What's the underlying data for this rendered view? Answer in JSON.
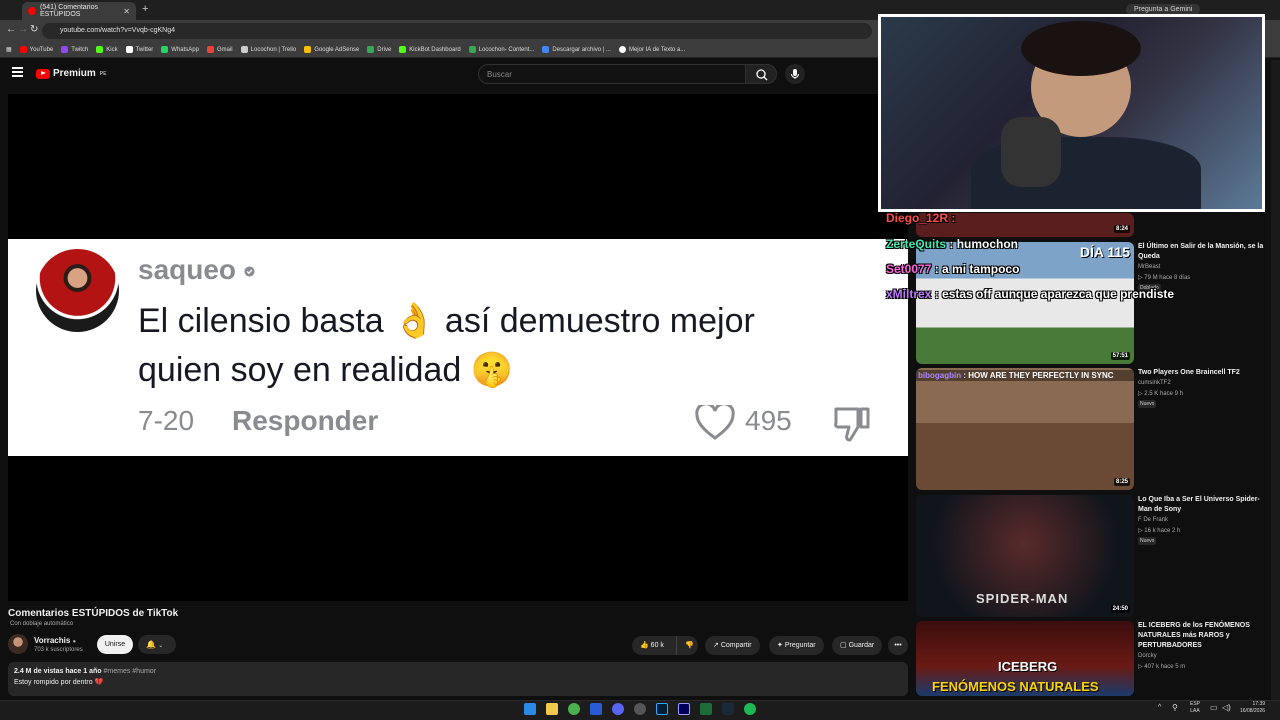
{
  "browser": {
    "tab_title": "(541) Comentarios ESTÚPIDOS",
    "gemini": "Pregunta a Gemini",
    "url": "youtube.com/watch?v=Vvqb-cgKNg4",
    "bookmarks": [
      "YouTube",
      "Twitch",
      "Kick",
      "Twitter",
      "WhatsApp",
      "Gmail",
      "Locochon | Trello",
      "Google AdSense",
      "Drive",
      "KickBot Dashboard",
      "Locochon- Content...",
      "Descargar archivo | ...",
      "Mejor IA de Texto a..."
    ]
  },
  "header": {
    "logo": "Premium",
    "logo_region": "PE",
    "search_placeholder": "Buscar"
  },
  "comment": {
    "username": "saqueo",
    "text_line1": "El cilensio basta 👌 así demuestro mejor",
    "text_line2": "quien soy en realidad 🤫",
    "date": "7-20",
    "reply": "Responder",
    "likes": "495"
  },
  "video": {
    "title": "Comentarios ESTÚPIDOS de TikTok",
    "dubbing": "Con doblaje automático",
    "channel": "Vorrachis",
    "subscribers": "703 k suscriptores",
    "join": "Unirse",
    "likes": "60 k",
    "share": "Compartir",
    "ask": "Preguntar",
    "save": "Guardar",
    "views_date": "2.4 M de vistas  hace 1 año",
    "tags": "#memes #humor",
    "description": "Estoy rompido por dentro 💔"
  },
  "chat": [
    {
      "user": "Diego_12R",
      "msg": ""
    },
    {
      "user": "ZerteQuits",
      "msg": "humochon"
    },
    {
      "user": "Set0077",
      "msg": "a mi tampoco"
    },
    {
      "user": "xMiltrex",
      "msg": "estas off aunque aparezca que prendiste"
    }
  ],
  "related": [
    {
      "title": "",
      "channel": "",
      "meta": "",
      "badge": "",
      "duration": "8:24",
      "color": "#5a1e1e"
    },
    {
      "title": "El Último en Salir de la Mansión, se la Queda",
      "channel": "MrBeast",
      "meta": "▷ 79 M  hace 8 días",
      "badge": "Doblado",
      "duration": "57:51",
      "thumb_text": "DÍA 115",
      "color": "#6d8fb5"
    },
    {
      "title": "Two Players One Braincell TF2",
      "channel": "cumsinkTF2",
      "meta": "▷ 2.5 K  hace 9 h",
      "badge": "Nuevo",
      "duration": "8:25",
      "thumb_text": "HOW ARE THEY PERFECTLY IN SYNC",
      "thumb_user": "bibogagbin",
      "color": "#5a4030"
    },
    {
      "title": "Lo Que Iba a Ser El Universo Spider-Man de Sony",
      "channel": "F De Frank",
      "meta": "▷ 16 k  hace 2 h",
      "badge": "Nuevo",
      "duration": "24:50",
      "thumb_text": "SPIDER-MAN",
      "color": "#1a2028"
    },
    {
      "title": "EL ICEBERG de los FENÓMENOS NATURALES más RAROS y PERTURBADORES",
      "channel": "Dorcky",
      "meta": "▷ 407 k  hace 5 m",
      "badge": "",
      "duration": "",
      "thumb_text": "ICEBERG",
      "thumb_text2": "FENÓMENOS NATURALES",
      "color": "#3a1010"
    }
  ],
  "taskbar": {
    "lang": "ESP",
    "lang2": "LAA",
    "time": "17:39",
    "date": "16/08/2026"
  }
}
